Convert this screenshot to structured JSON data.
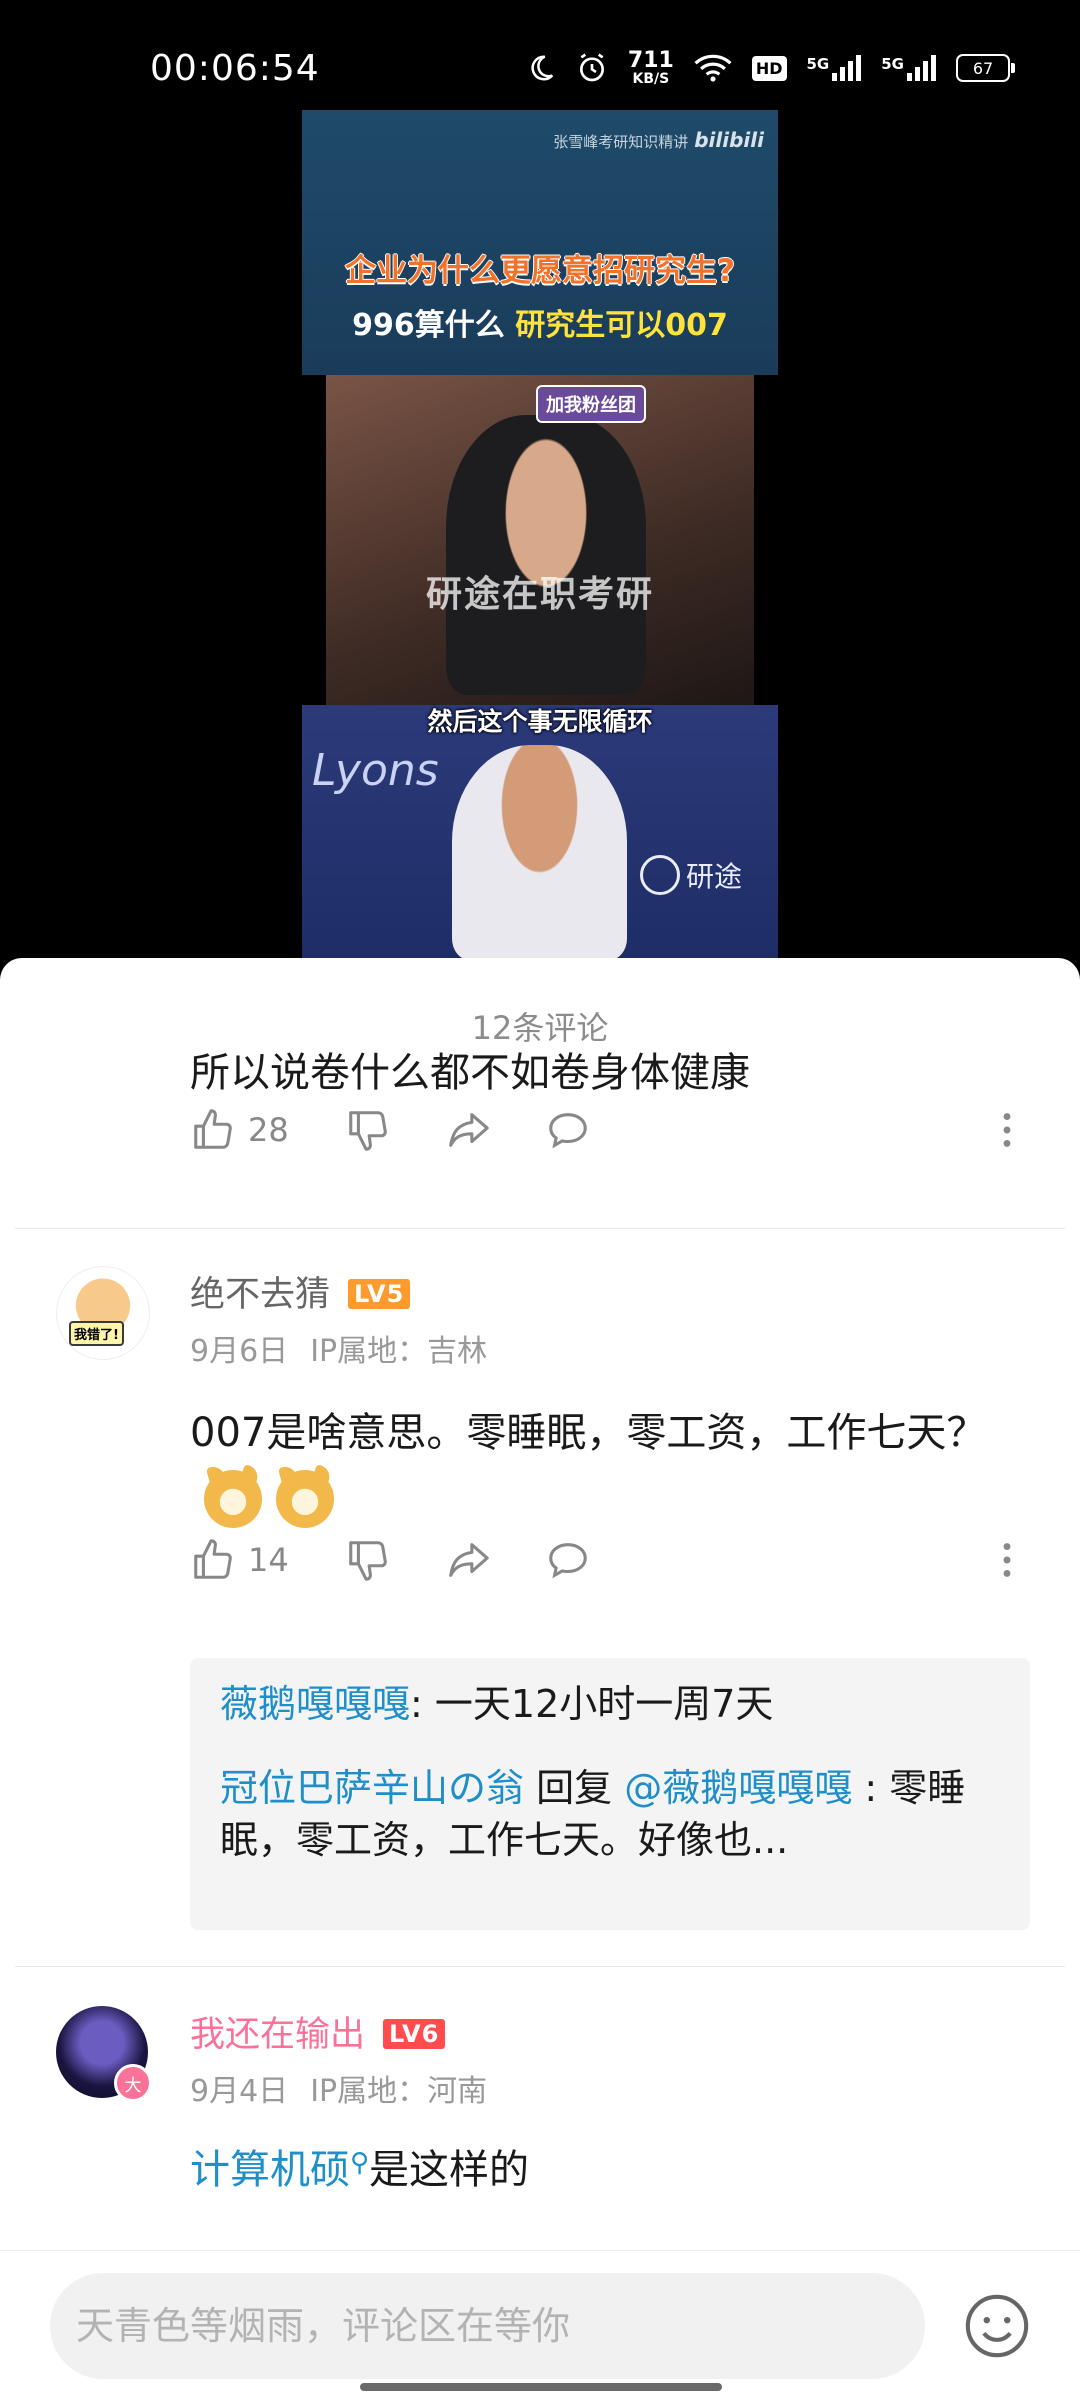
{
  "status_bar": {
    "time": "00:06:54",
    "net_speed_value": "711",
    "net_speed_unit": "KB/S",
    "hd_label": "HD",
    "signal1_label": "5G",
    "signal2_label": "5G",
    "battery": "67",
    "icons": [
      "moon-icon",
      "alarm-icon",
      "wifi-icon",
      "hd-icon",
      "signal-icon",
      "signal-icon",
      "battery-icon"
    ]
  },
  "video": {
    "watermark_text": "张雪峰考研知识精讲",
    "watermark_brand": "bilibili",
    "headline_line1": "企业为什么更愿意招研究生?",
    "headline_line2_part1": "996算什么",
    "headline_line2_part2": "研究生可以007",
    "fan_badge": "加我粉丝团",
    "overlay_text": "研途在职考研",
    "subtitle": "然后这个事无限循环",
    "background_text": "Lyons",
    "logo_text": "研途"
  },
  "comments": {
    "count_label": "12条评论",
    "top": {
      "text": "所以说卷什么都不如卷身体健康",
      "likes": "28"
    },
    "items": [
      {
        "username": "绝不去猜",
        "level": "LV5",
        "date": "9月6日",
        "ip": "IP属地：吉林",
        "text": "007是啥意思。零睡眠，零工资，工作七天？",
        "likes": "14",
        "replies": [
          {
            "user": "薇鹅嘎嘎嘎",
            "text": ": 一天12小时一周7天"
          },
          {
            "user": "冠位巴萨辛山の翁",
            "verb": "回复",
            "mention": "@薇鹅嘎嘎嘎",
            "text": ": 零睡眠，零工资，工作七天。好像也..."
          }
        ]
      },
      {
        "username": "我还在输出",
        "level": "LV6",
        "badge": "大",
        "date": "9月4日",
        "ip": "IP属地：河南",
        "link_text": "计算机硕",
        "text": "是这样的"
      }
    ]
  },
  "input": {
    "placeholder": "天青色等烟雨，评论区在等你"
  },
  "colors": {
    "accent_pink": "#fb7299",
    "link_blue": "#1e8fc8",
    "level5": "#ff9a2e",
    "level6": "#ff4d4d"
  }
}
